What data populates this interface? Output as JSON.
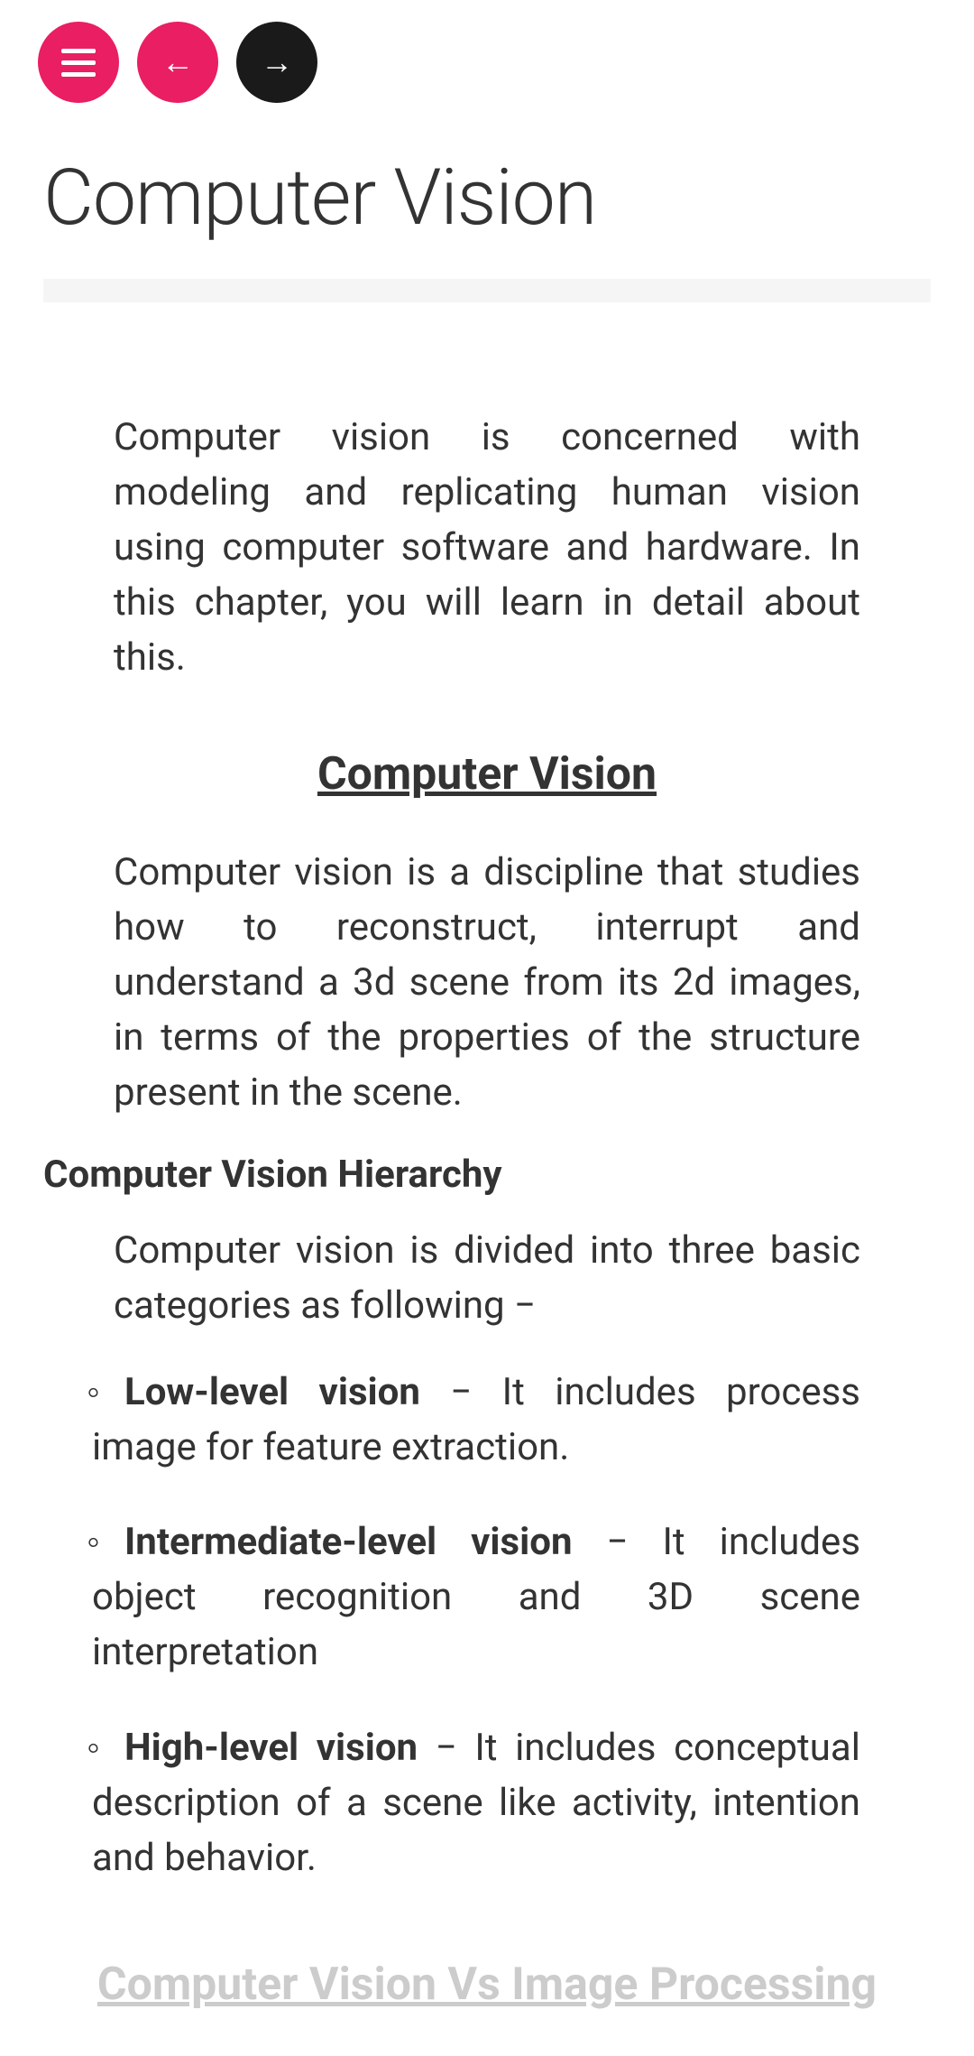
{
  "nav": {
    "back_arrow": "←",
    "forward_arrow": "→"
  },
  "page_title": "Computer Vision",
  "intro": "Computer vision is concerned with modeling and replicating human vision using computer software and hardware. In this chapter, you will learn in detail about this.",
  "section1_heading": "Computer Vision",
  "section1_body": "Computer vision is a discipline that studies how to reconstruct, interrupt and understand a 3d scene from its 2d images, in terms of the properties of the structure present in the scene.",
  "hierarchy_heading": "Computer Vision Hierarchy",
  "hierarchy_intro": "Computer vision is divided into three basic categories as following −",
  "bullets": [
    {
      "title": "Low-level vision",
      "desc": " − It includes process image for feature extraction."
    },
    {
      "title": "Intermediate-level vision",
      "desc": " − It includes object recognition and 3D scene interpretation"
    },
    {
      "title": "High-level vision",
      "desc": " − It includes conceptual description of a scene like activity, intention and behavior."
    }
  ],
  "section2_heading": "Computer Vision Vs Image Processing"
}
